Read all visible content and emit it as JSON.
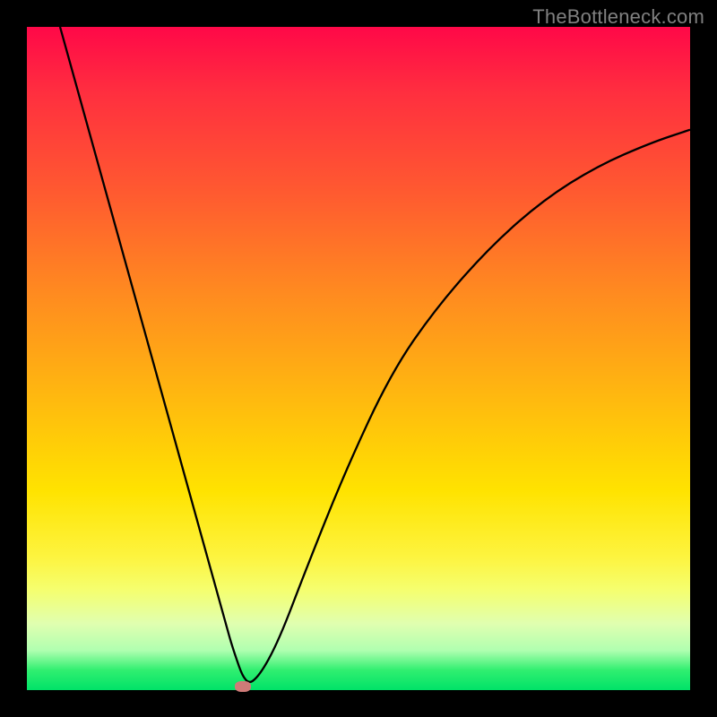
{
  "watermark": "TheBottleneck.com",
  "chart_data": {
    "type": "line",
    "title": "",
    "xlabel": "",
    "ylabel": "",
    "xlim": [
      0,
      100
    ],
    "ylim": [
      0,
      100
    ],
    "series": [
      {
        "name": "curve",
        "x": [
          5,
          10,
          15,
          20,
          25,
          27,
          29,
          30,
          31,
          33,
          35,
          38,
          42,
          48,
          55,
          62,
          70,
          78,
          86,
          94,
          100
        ],
        "values": [
          100,
          82,
          64,
          46,
          28,
          20.8,
          13.6,
          10,
          6.4,
          0.7,
          2.0,
          7.5,
          18,
          33,
          48,
          58,
          67,
          74,
          79,
          82.5,
          84.5
        ]
      }
    ],
    "gradient_stops": [
      {
        "pos": 0.0,
        "color": "#ff0848"
      },
      {
        "pos": 0.1,
        "color": "#ff2f3f"
      },
      {
        "pos": 0.25,
        "color": "#ff5a30"
      },
      {
        "pos": 0.4,
        "color": "#ff8a20"
      },
      {
        "pos": 0.55,
        "color": "#ffb610"
      },
      {
        "pos": 0.7,
        "color": "#ffe300"
      },
      {
        "pos": 0.8,
        "color": "#fdf440"
      },
      {
        "pos": 0.85,
        "color": "#f5ff70"
      },
      {
        "pos": 0.9,
        "color": "#e0ffb0"
      },
      {
        "pos": 0.94,
        "color": "#b0ffb0"
      },
      {
        "pos": 0.97,
        "color": "#30ef70"
      },
      {
        "pos": 1.0,
        "color": "#00e268"
      }
    ],
    "marker": {
      "x": 32.5,
      "y": 0.6,
      "color": "#cf7b78"
    },
    "curve_stroke": "#000000",
    "curve_width": 2.3
  }
}
